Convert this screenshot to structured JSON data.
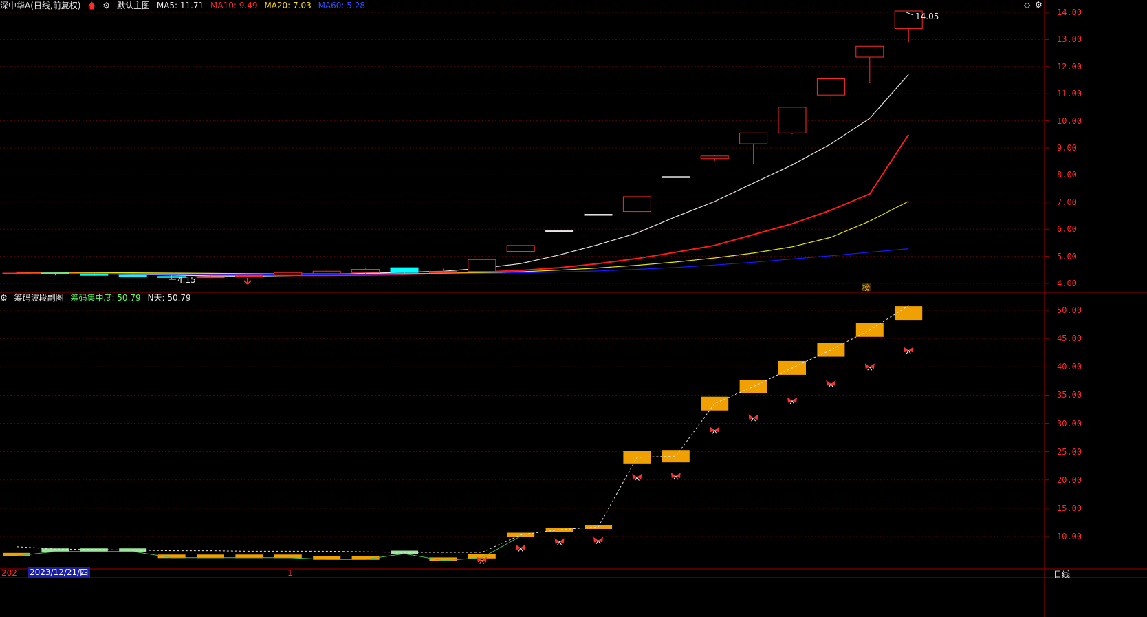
{
  "main_chart": {
    "title": "深中华A(日线,前复权)",
    "template": "默认主图",
    "ma5": "MA5: 11.71",
    "ma10": "MA10: 9.49",
    "ma20": "MA20: 7.03",
    "ma60": "MA60: 5.28",
    "high_label": "14.05",
    "low_label": "4.15",
    "marker_text": "榜",
    "y_ticks": [
      "14.00",
      "13.00",
      "12.00",
      "11.00",
      "10.00",
      "9.00",
      "8.00",
      "7.00",
      "6.00",
      "5.00",
      "4.00"
    ]
  },
  "sub_chart": {
    "title": "筹码波段副图",
    "concentration": "筹码集中度: 50.79",
    "n_days": "N天: 50.79",
    "y_ticks": [
      "50.00",
      "45.00",
      "40.00",
      "35.00",
      "30.00",
      "25.00",
      "20.00",
      "15.00",
      "10.00"
    ]
  },
  "footer": {
    "date_prefix": "202",
    "date": "2023/12/21/四",
    "cursor_mark": "1",
    "period": "日线"
  },
  "colors": {
    "up": "#ff2a2a",
    "down": "#00ffff",
    "ma5": "#e6e6e6",
    "ma10": "#ff1a1a",
    "ma20": "#e6e600",
    "ma60": "#1a1aff",
    "chip_bar": "#f0a000",
    "chip_green": "#9be59b"
  },
  "chart_data": [
    {
      "type": "candlestick",
      "title": "深中华A(日线,前复权)",
      "ylim": [
        3.85,
        14.1
      ],
      "candles": [
        {
          "o": 4.35,
          "h": 4.42,
          "l": 4.32,
          "c": 4.38
        },
        {
          "o": 4.38,
          "h": 4.42,
          "l": 4.3,
          "c": 4.35
        },
        {
          "o": 4.35,
          "h": 4.38,
          "l": 4.28,
          "c": 4.3
        },
        {
          "o": 4.3,
          "h": 4.33,
          "l": 4.24,
          "c": 4.26
        },
        {
          "o": 4.26,
          "h": 4.3,
          "l": 4.15,
          "c": 4.22
        },
        {
          "o": 4.22,
          "h": 4.28,
          "l": 4.2,
          "c": 4.25
        },
        {
          "o": 4.25,
          "h": 4.32,
          "l": 4.23,
          "c": 4.3
        },
        {
          "o": 4.3,
          "h": 4.42,
          "l": 4.29,
          "c": 4.4
        },
        {
          "o": 4.36,
          "h": 4.48,
          "l": 4.33,
          "c": 4.45
        },
        {
          "o": 4.4,
          "h": 4.55,
          "l": 4.36,
          "c": 4.52
        },
        {
          "o": 4.58,
          "h": 4.58,
          "l": 4.36,
          "c": 4.4
        },
        {
          "o": 4.4,
          "h": 4.55,
          "l": 4.38,
          "c": 4.44
        },
        {
          "o": 4.44,
          "h": 4.9,
          "l": 4.42,
          "c": 4.88
        },
        {
          "o": 5.18,
          "h": 5.4,
          "l": 5.18,
          "c": 5.4
        },
        {
          "o": 5.92,
          "h": 5.94,
          "l": 5.92,
          "c": 5.94
        },
        {
          "o": 6.53,
          "h": 6.55,
          "l": 6.53,
          "c": 6.55
        },
        {
          "o": 6.65,
          "h": 7.2,
          "l": 6.62,
          "c": 7.2
        },
        {
          "o": 7.92,
          "h": 7.94,
          "l": 7.92,
          "c": 7.94
        },
        {
          "o": 8.6,
          "h": 8.72,
          "l": 8.52,
          "c": 8.7
        },
        {
          "o": 9.15,
          "h": 9.55,
          "l": 8.4,
          "c": 9.55
        },
        {
          "o": 9.55,
          "h": 10.5,
          "l": 9.5,
          "c": 10.5
        },
        {
          "o": 10.95,
          "h": 11.55,
          "l": 10.7,
          "c": 11.55
        },
        {
          "o": 12.35,
          "h": 12.75,
          "l": 11.4,
          "c": 12.75
        },
        {
          "o": 13.4,
          "h": 14.05,
          "l": 12.9,
          "c": 14.05
        }
      ],
      "series": [
        {
          "name": "MA5",
          "values": [
            4.36,
            4.36,
            4.35,
            4.33,
            4.31,
            4.28,
            4.27,
            4.29,
            4.33,
            4.37,
            4.41,
            4.45,
            4.56,
            4.73,
            5.05,
            5.43,
            5.86,
            6.46,
            7.02,
            7.7,
            8.37,
            9.15,
            10.09,
            11.71
          ]
        },
        {
          "name": "MA10",
          "values": [
            4.4,
            4.39,
            4.38,
            4.36,
            4.35,
            4.33,
            4.31,
            4.3,
            4.3,
            4.31,
            4.33,
            4.37,
            4.42,
            4.48,
            4.58,
            4.73,
            4.92,
            5.15,
            5.4,
            5.8,
            6.2,
            6.7,
            7.3,
            9.49
          ]
        },
        {
          "name": "MA20",
          "values": [
            4.42,
            4.41,
            4.4,
            4.39,
            4.38,
            4.37,
            4.36,
            4.35,
            4.35,
            4.35,
            4.36,
            4.37,
            4.39,
            4.43,
            4.49,
            4.57,
            4.67,
            4.79,
            4.94,
            5.12,
            5.35,
            5.7,
            6.3,
            7.03
          ]
        },
        {
          "name": "MA60",
          "values": [
            4.35,
            4.35,
            4.34,
            4.34,
            4.33,
            4.33,
            4.32,
            4.32,
            4.32,
            4.33,
            4.34,
            4.35,
            4.37,
            4.39,
            4.42,
            4.46,
            4.52,
            4.59,
            4.68,
            4.78,
            4.9,
            5.02,
            5.15,
            5.28
          ]
        }
      ]
    },
    {
      "type": "bar",
      "title": "筹码波段副图",
      "ylim": [
        6,
        53
      ],
      "values": [
        6.8,
        7.6,
        7.6,
        7.6,
        6.5,
        6.5,
        6.5,
        6.5,
        6.2,
        6.2,
        7.2,
        6.0,
        6.5,
        10.3,
        11.2,
        11.7,
        24.0,
        24.2,
        33.5,
        36.5,
        39.8,
        43.0,
        46.5,
        49.5
      ],
      "colors_by_index": {
        "1": "green",
        "2": "green",
        "3": "green",
        "10": "green"
      },
      "dashed_line": [
        8.2,
        7.8,
        7.7,
        7.6,
        7.5,
        7.5,
        7.4,
        7.4,
        7.4,
        7.3,
        7.2,
        7.2,
        7.2,
        10.3,
        11.2,
        11.7,
        24.0,
        24.2,
        33.5,
        36.5,
        39.8,
        43.0,
        46.5,
        50.79
      ],
      "signals": [
        null,
        null,
        null,
        null,
        null,
        null,
        null,
        null,
        null,
        null,
        null,
        null,
        5.8,
        8.0,
        9.1,
        9.3,
        20.5,
        20.7,
        28.8,
        31.0,
        34.0,
        37.0,
        40.0,
        42.9
      ]
    }
  ]
}
